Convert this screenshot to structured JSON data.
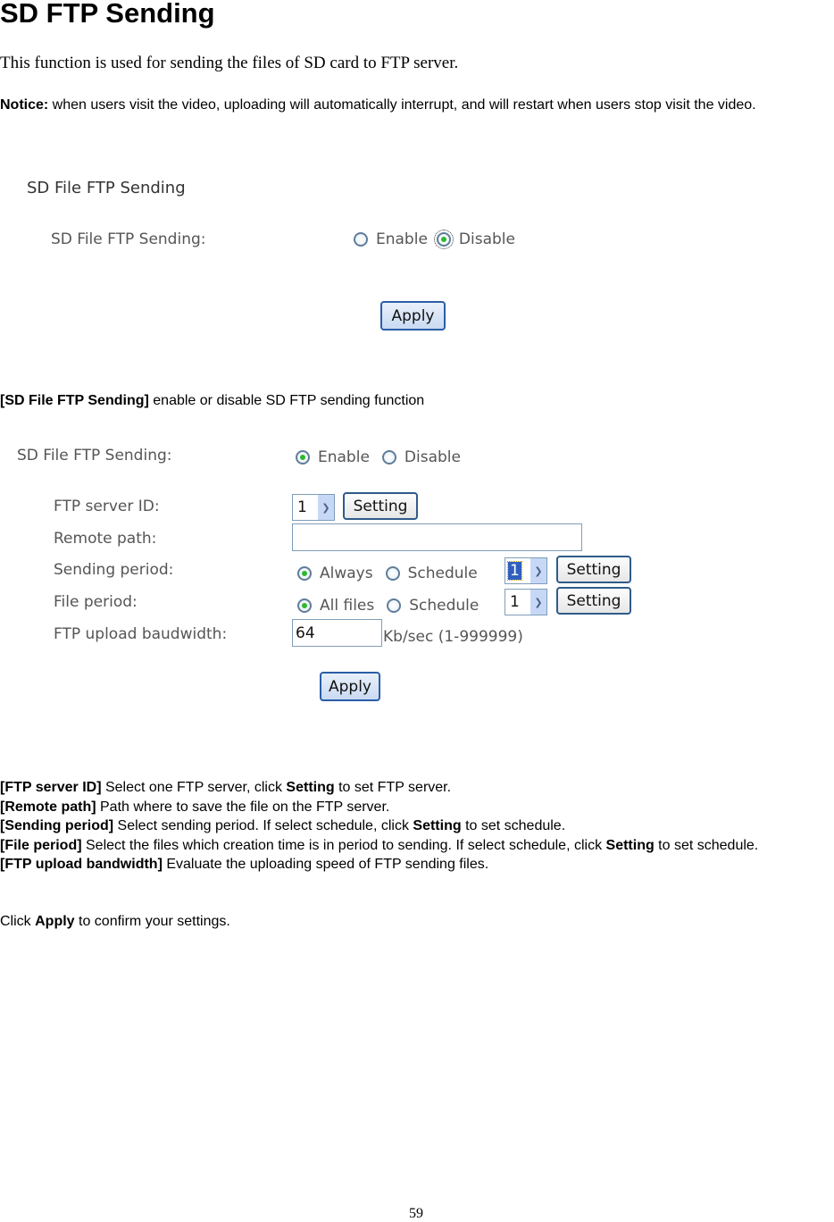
{
  "heading": "SD FTP Sending",
  "intro": "This function is used for sending the files of SD card to FTP server.",
  "notice": {
    "label": "Notice:",
    "text": " when users visit the video, uploading will automatically interrupt, and will restart when users stop visit the video."
  },
  "panel1": {
    "title": "SD File FTP Sending",
    "field_label": "SD File FTP Sending:",
    "options": [
      {
        "label": "Enable",
        "checked": false
      },
      {
        "label": "Disable",
        "checked": true
      }
    ],
    "apply_label": "Apply"
  },
  "desc1": {
    "term": "[SD File FTP Sending]",
    "text": " enable or disable SD FTP sending function"
  },
  "panel2": {
    "sending": {
      "label": "SD File FTP Sending:",
      "options": [
        {
          "label": "Enable",
          "checked": true
        },
        {
          "label": "Disable",
          "checked": false
        }
      ]
    },
    "server_id": {
      "label": "FTP server ID:",
      "value": "1",
      "setting_label": "Setting"
    },
    "remote_path": {
      "label": "Remote path:",
      "value": ""
    },
    "sending_period": {
      "label": "Sending period:",
      "options": [
        {
          "label": "Always",
          "checked": true
        },
        {
          "label": "Schedule",
          "checked": false
        }
      ],
      "schedule_value": "1",
      "setting_label": "Setting"
    },
    "file_period": {
      "label": "File period:",
      "options": [
        {
          "label": "All files",
          "checked": true
        },
        {
          "label": "Schedule",
          "checked": false
        }
      ],
      "schedule_value": "1",
      "setting_label": "Setting"
    },
    "bandwidth": {
      "label": "FTP upload baudwidth:",
      "value": "64",
      "suffix": "Kb/sec (1-999999)"
    },
    "apply_label": "Apply"
  },
  "descriptions": [
    {
      "term": "[FTP server ID]",
      "parts": [
        " Select one FTP server, click ",
        "Setting",
        " to set FTP server."
      ]
    },
    {
      "term": "[Remote path]",
      "parts": [
        " Path where to save the file on the FTP server.",
        "",
        ""
      ]
    },
    {
      "term": "[Sending period]",
      "parts": [
        " Select sending period. If select schedule, click ",
        "Setting",
        " to set schedule."
      ]
    },
    {
      "term": "[File period]",
      "parts": [
        " Select the files which creation time is in period to sending. If select schedule, click ",
        "Setting",
        " to set schedule."
      ]
    },
    {
      "term": "[FTP upload bandwidth]",
      "parts": [
        " Evaluate the uploading speed of FTP sending files.",
        "",
        ""
      ]
    }
  ],
  "closing": {
    "pre": "Click ",
    "strong": "Apply",
    "post": " to confirm your settings."
  },
  "page_number": "59"
}
